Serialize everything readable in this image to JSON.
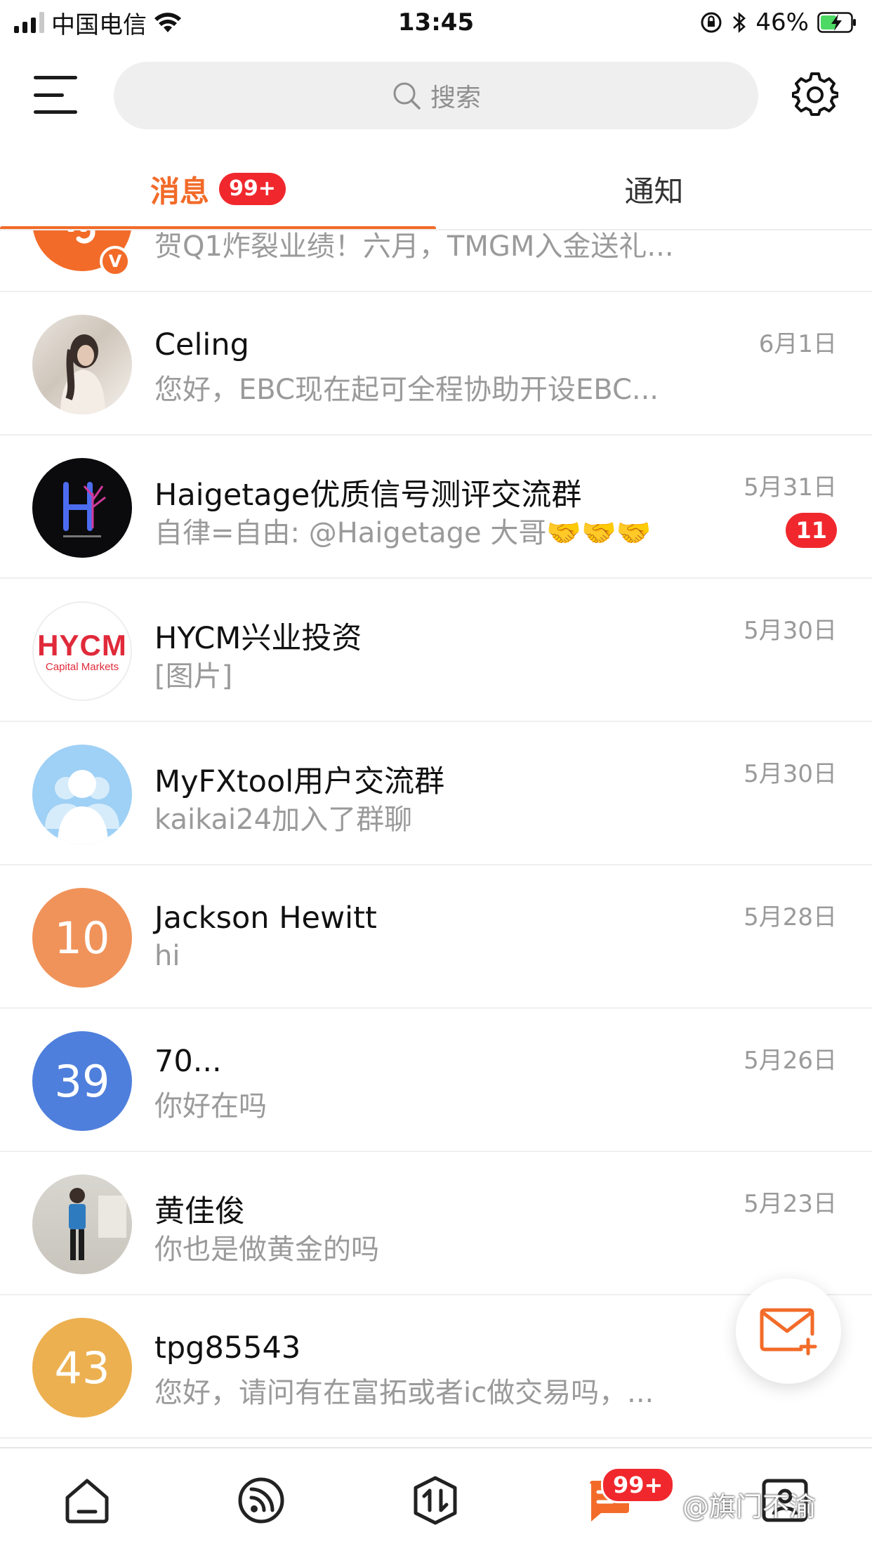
{
  "status_bar": {
    "carrier": "中国电信",
    "time": "13:45",
    "battery": "46%"
  },
  "header": {
    "search_placeholder": "搜索"
  },
  "tabs": {
    "messages_label": "消息",
    "messages_badge": "99+",
    "notices_label": "通知"
  },
  "conversations": [
    {
      "name": "",
      "preview": "贺Q1炸裂业绩！六月，TMGM入金送礼...",
      "date": "",
      "verified_badge": "V",
      "avatar_color": "#f26b29"
    },
    {
      "name": "Celing",
      "preview": "您好，EBC现在起可全程协助开设EBC...",
      "date": "6月1日"
    },
    {
      "name": "Haigetage优质信号测评交流群",
      "preview": "自律=自由: @Haigetage 大哥🤝🤝🤝",
      "date": "5月31日",
      "unread": "11"
    },
    {
      "name": "HYCM兴业投资",
      "preview": "[图片]",
      "date": "5月30日",
      "avatar_text": "HYCM",
      "avatar_subtext": "Capital Markets"
    },
    {
      "name": "MyFXtool用户交流群",
      "preview": "kaikai24加入了群聊",
      "date": "5月30日"
    },
    {
      "name": "Jackson Hewitt",
      "preview": "hi",
      "date": "5月28日",
      "avatar_number": "10",
      "avatar_color": "#f0935a"
    },
    {
      "name": "70...",
      "preview": "你好在吗",
      "date": "5月26日",
      "avatar_number": "39",
      "avatar_color": "#4f7fdc"
    },
    {
      "name": "黄佳俊",
      "preview": "你也是做黄金的吗",
      "date": "5月23日"
    },
    {
      "name": "tpg85543",
      "preview": "您好，请问有在富拓或者ic做交易吗，...",
      "date": "",
      "avatar_number": "43",
      "avatar_color": "#ecb050"
    }
  ],
  "bottom_nav": {
    "messages_badge": "99+",
    "watermark": "@旗门不渝"
  },
  "colors": {
    "accent": "#f26b29",
    "badge_red": "#f0282d"
  },
  "icons": [
    "menu-icon",
    "search-icon",
    "gear-icon",
    "compose-mail-icon",
    "home-icon",
    "feed-icon",
    "market-icon",
    "messages-icon",
    "profile-icon"
  ]
}
